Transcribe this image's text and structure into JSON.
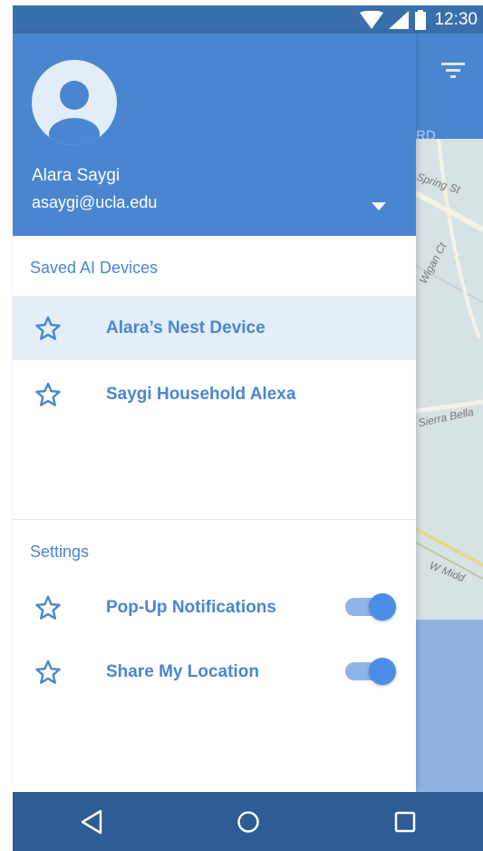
{
  "status_bar": {
    "time": "12:30"
  },
  "app_behind": {
    "tab_fragment": "RD",
    "map_labels": [
      "Spring St",
      "Wigan Ct",
      "Sierra Bella",
      "W Midd"
    ]
  },
  "drawer": {
    "user": {
      "name": "Alara Saygi",
      "email": "asaygi@ucla.edu"
    },
    "devices_section": {
      "title": "Saved AI Devices",
      "items": [
        {
          "label": "Alara’s Nest Device",
          "icon": "star-outline-icon",
          "selected": true
        },
        {
          "label": "Saygi Household Alexa",
          "icon": "star-outline-icon",
          "selected": false
        }
      ]
    },
    "settings_section": {
      "title": "Settings",
      "items": [
        {
          "label": "Pop-Up Notifications",
          "icon": "star-outline-icon",
          "enabled": true
        },
        {
          "label": "Share My Location",
          "icon": "star-outline-icon",
          "enabled": true
        }
      ]
    }
  },
  "nav_bar": {
    "buttons": [
      "back-icon",
      "home-icon",
      "recents-icon"
    ]
  },
  "colors": {
    "primary": "#4a86d0",
    "status_bar": "#3a6fad",
    "nav_bar": "#2e5c95",
    "selected_row": "#e3eef9",
    "toggle_thumb": "#4a8ee6"
  }
}
